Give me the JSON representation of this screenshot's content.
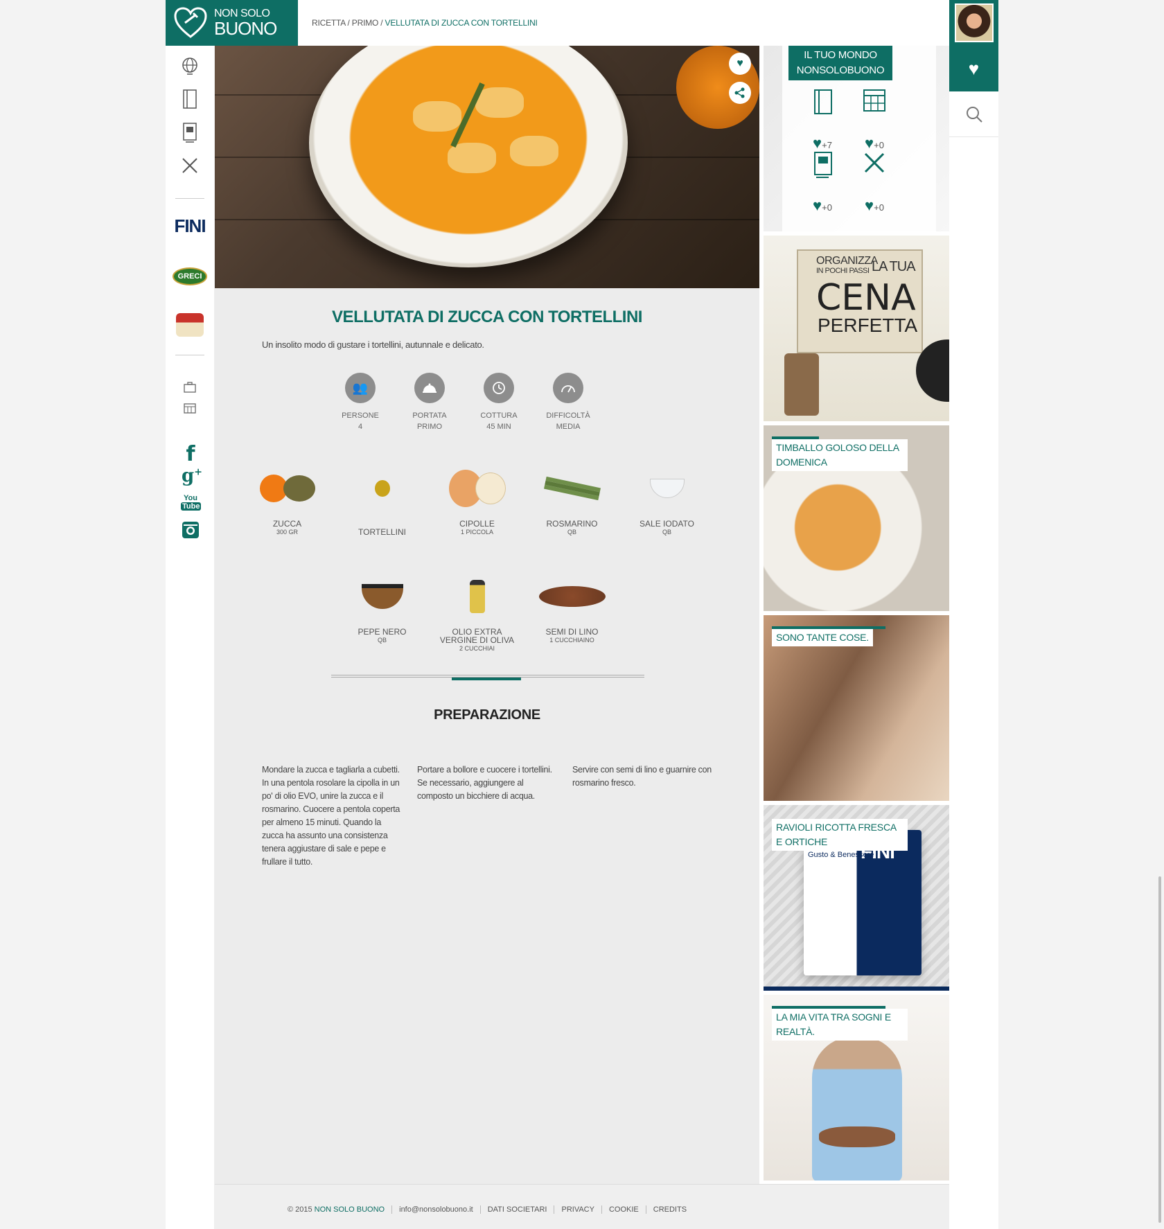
{
  "header": {
    "logo_line1": "NON SOLO",
    "logo_line2": "BUONO",
    "breadcrumb": [
      "RICETTA",
      "PRIMO",
      "VELLUTATA DI ZUCCA CON TORTELLINI"
    ],
    "breadcrumb_sep": " / "
  },
  "left_nav": {
    "icons": [
      "globe-icon",
      "book-icon",
      "cookbook-icon",
      "utensils-icon",
      "briefcase-icon",
      "calendar-icon"
    ],
    "brands": [
      "FINI",
      "GRECI"
    ],
    "social": [
      "facebook-icon",
      "google-plus-icon",
      "youtube-icon",
      "instagram-icon"
    ],
    "youtube_you": "You",
    "youtube_tube": "Tube"
  },
  "recipe": {
    "title": "VELLUTATA DI ZUCCA CON TORTELLINI",
    "subtitle": "Un insolito modo di gustare i tortellini, autunnale e delicato.",
    "facts": [
      {
        "label": "PERSONE",
        "value": "4",
        "icon": "people-icon"
      },
      {
        "label": "PORTATA",
        "value": "PRIMO",
        "icon": "cloche-icon"
      },
      {
        "label": "COTTURA",
        "value": "45 MIN",
        "icon": "timer-icon"
      },
      {
        "label": "DIFFICOLTÀ",
        "value": "MEDIA",
        "icon": "gauge-icon"
      }
    ],
    "ingredients_row1": [
      {
        "name": "ZUCCA",
        "qty": "300 GR"
      },
      {
        "name": "TORTELLINI",
        "qty": ""
      },
      {
        "name": "CIPOLLE",
        "qty": "1 PICCOLA"
      },
      {
        "name": "ROSMARINO",
        "qty": "QB"
      },
      {
        "name": "SALE IODATO",
        "qty": "QB"
      }
    ],
    "ingredients_row2": [
      {
        "name": "PEPE NERO",
        "qty": "QB"
      },
      {
        "name": "OLIO EXTRA VERGINE DI OLIVA",
        "qty": "2 CUCCHIAI"
      },
      {
        "name": "SEMI DI LINO",
        "qty": "1 CUCCHIAINO"
      }
    ],
    "prep_title": "PREPARAZIONE",
    "steps": [
      "Mondare la zucca e tagliarla a cubetti. In una pentola rosolare la cipolla in un po' di olio EVO, unire la zucca e il rosmarino. Cuocere a pentola coperta per almeno 15 minuti. Quando la zucca ha assunto una consistenza tenera aggiustare di sale e pepe e frullare il tutto.",
      "Portare a bollore e cuocere i tortellini. Se necessario, aggiungere al composto un bicchiere di acqua.",
      "Servire con semi di lino e guarnire con rosmarino fresco."
    ]
  },
  "world": {
    "title": "IL TUO MONDO NONSOLOBUONO",
    "counts": [
      "7",
      "0",
      "0",
      "0"
    ]
  },
  "cena": {
    "line1": "ORGANIZZA",
    "line2": "IN POCHI PASSI",
    "line3": "LA TUA",
    "big": "CENA",
    "sub": "PERFETTA"
  },
  "tiles": [
    {
      "label": "TIMBALLO GOLOSO DELLA DOMENICA"
    },
    {
      "label": "SONO TANTE COSE."
    },
    {
      "label": "RAVIOLI RICOTTA FRESCA E ORTICHE"
    },
    {
      "label": "LA MIA VITA TRA SOGNI E REALTÀ."
    }
  ],
  "ravioli_pack": {
    "brand": "FINI",
    "line": "Gusto & Benessere"
  },
  "footer": {
    "copyright": "© 2015 ",
    "brand": "NON SOLO BUONO",
    "links": [
      "info@nonsolobuono.it",
      "DATI SOCIETARI",
      "PRIVACY",
      "COOKIE",
      "CREDITS"
    ]
  },
  "colors": {
    "brand_teal": "#0e6e64",
    "bg_grey": "#ececec"
  }
}
